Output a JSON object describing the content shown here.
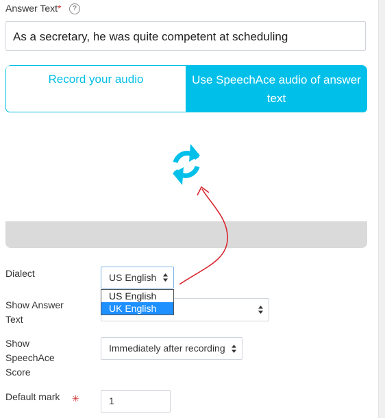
{
  "answer": {
    "label": "Answer Text",
    "required_mark": "*",
    "help_icon": "question-circle-icon",
    "value": "As a secretary, he was quite competent at scheduling"
  },
  "audio_panel": {
    "tab_record": "Record your audio",
    "tab_speechace": "Use SpeechAce audio of answer text",
    "active_tab": "tab_speechace",
    "status_icon": "refresh-icon",
    "accent_color": "#00c0ea"
  },
  "dialect": {
    "label": "Dialect",
    "value": "US English",
    "options": [
      "US English",
      "UK English"
    ],
    "highlighted_option": "UK English"
  },
  "show_answer_text": {
    "label": "Show Answer Text",
    "value": ""
  },
  "show_score": {
    "label": "Show SpeechAce Score",
    "value": "Immediately after recording"
  },
  "default_mark": {
    "label": "Default mark",
    "required_icon": "asterisk-icon",
    "value": "1"
  },
  "annotation": {
    "arrow_color": "#d8262f"
  }
}
